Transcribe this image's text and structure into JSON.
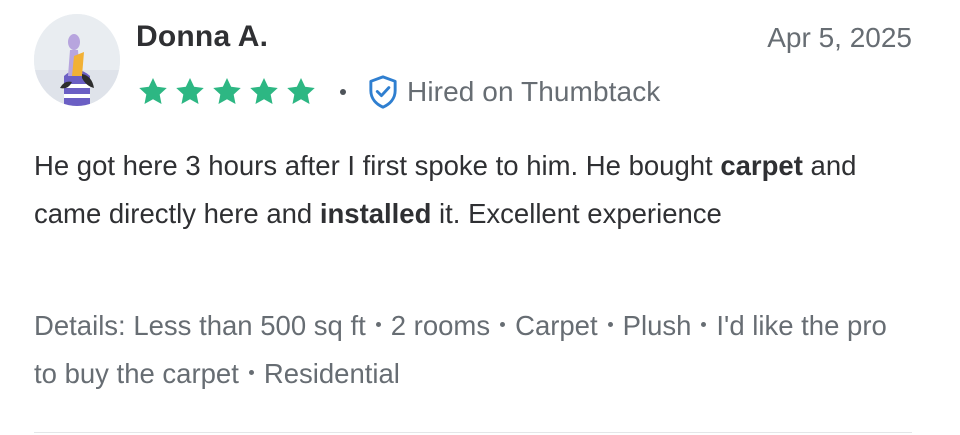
{
  "review": {
    "reviewer_name": "Donna A.",
    "date": "Apr 5, 2025",
    "rating": 5,
    "rating_max": 5,
    "star_color": "#2db783",
    "hired_badge_icon": "shield-check-icon",
    "hired_badge_color": "#2f7fd0",
    "hired_label": "Hired on Thumbtack",
    "body": {
      "part1": "He got here 3 hours after I first spoke to him. He bought ",
      "bold1": "carpet",
      "part2": " and came directly here and ",
      "bold2": "installed",
      "part3": " it. Excellent experience"
    },
    "details_prefix": "Details: ",
    "details": [
      "Less than 500 sq ft",
      "2 rooms",
      "Carpet",
      "Plush",
      "I'd like the pro to buy the carpet",
      "Residential"
    ]
  }
}
